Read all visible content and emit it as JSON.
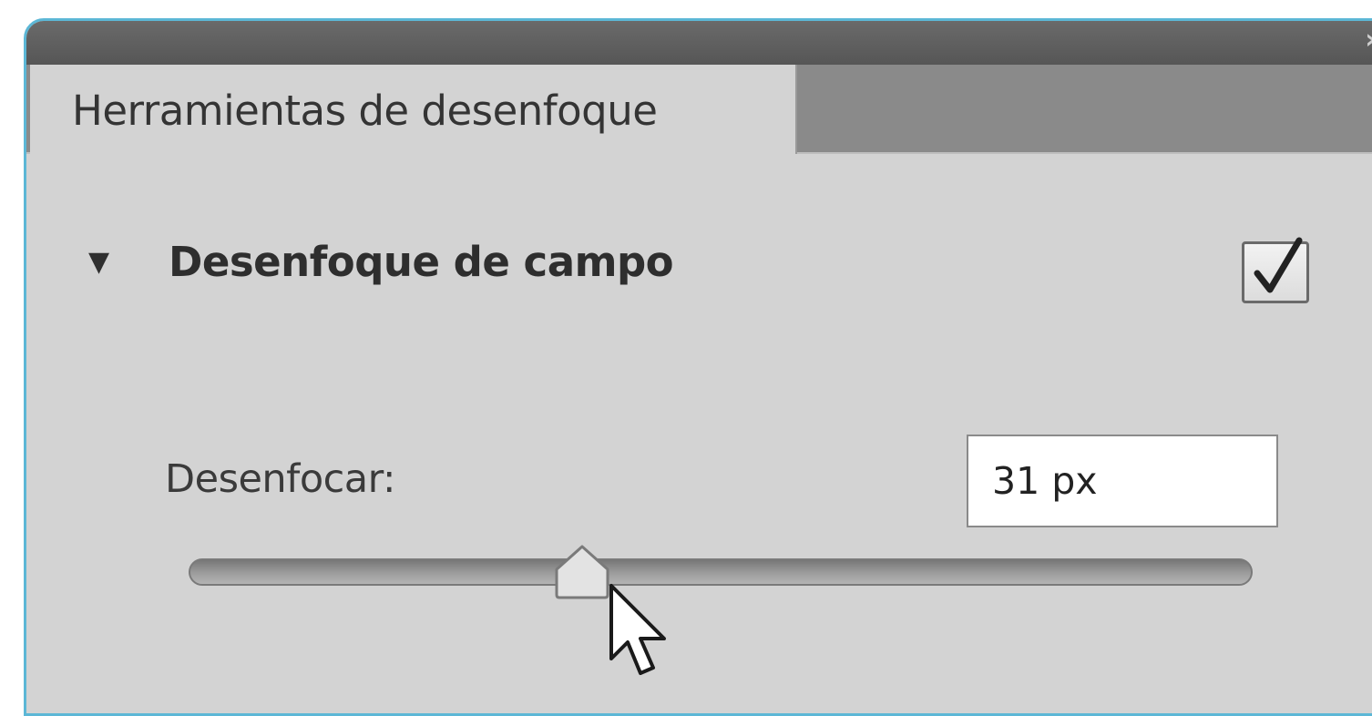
{
  "panel": {
    "tab_label": "Herramientas de desenfoque",
    "collapse_icon": "double-chevron-right-icon"
  },
  "section": {
    "title": "Desenfoque de campo",
    "expanded": true,
    "enabled_checked": true
  },
  "blur": {
    "label": "Desenfocar:",
    "value": "31 px",
    "slider_fraction": 0.38
  },
  "colors": {
    "accent_border": "#5cb7d6",
    "panel_bg": "#d3d3d3",
    "titlebar_bg": "#5e5e5e"
  }
}
